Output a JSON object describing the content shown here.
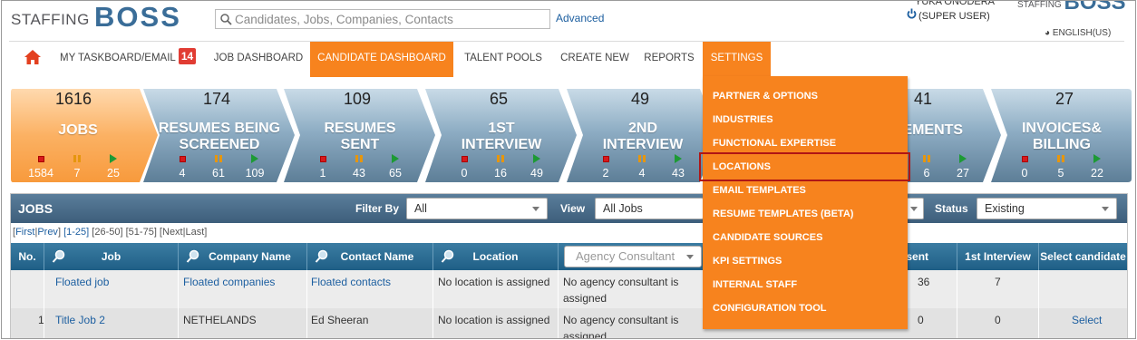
{
  "header": {
    "logo_text": "STAFFING",
    "logo_bold": "BOSS",
    "search_placeholder": "Candidates, Jobs, Companies, Contacts",
    "advanced_label": "Advanced",
    "user_name": "YUKA ONODERA",
    "user_role": "(SUPER USER)",
    "logo2_text": "STAFFING",
    "logo2_bold": "BOSS",
    "language": "ENGLISH(US)"
  },
  "nav": {
    "items": [
      {
        "label": "MY TASKBOARD/EMAIL",
        "badge": "14"
      },
      {
        "label": "JOB DASHBOARD"
      },
      {
        "label": "CANDIDATE DASHBOARD",
        "active": true
      },
      {
        "label": "TALENT POOLS"
      },
      {
        "label": "CREATE NEW"
      },
      {
        "label": "REPORTS"
      },
      {
        "label": "SETTINGS",
        "active": true
      }
    ]
  },
  "pipeline": [
    {
      "count": "1616",
      "label1": "JOBS",
      "label2": "",
      "stats": [
        "1584",
        "7",
        "25"
      ]
    },
    {
      "count": "174",
      "label1": "RESUMES BEING",
      "label2": "SCREENED",
      "stats": [
        "4",
        "61",
        "109"
      ]
    },
    {
      "count": "109",
      "label1": "RESUMES",
      "label2": "SENT",
      "stats": [
        "1",
        "43",
        "65"
      ]
    },
    {
      "count": "65",
      "label1": "1ST",
      "label2": "INTERVIEW",
      "stats": [
        "0",
        "16",
        "49"
      ]
    },
    {
      "count": "49",
      "label1": "2ND",
      "label2": "INTERVIEW",
      "stats": [
        "2",
        "4",
        "43"
      ]
    },
    {
      "count": "41",
      "label1": "CEMENTS",
      "label2": "",
      "stats": [
        "8",
        "6",
        "27"
      ]
    },
    {
      "count": "27",
      "label1": "INVOICES&",
      "label2": "BILLING",
      "stats": [
        "0",
        "5",
        "22"
      ]
    }
  ],
  "jobs_panel": {
    "title": "JOBS",
    "filter_by_label": "Filter By",
    "filter_by_value": "All",
    "view_label": "View",
    "view_value": "All Jobs",
    "status_label": "Status",
    "status_value": "Existing",
    "pager": {
      "first": "First",
      "prev": "Prev",
      "ranges": [
        "1-25",
        "26-50",
        "51-75"
      ],
      "next": "Next",
      "last": "Last"
    },
    "columns": [
      "No.",
      "Job",
      "Company Name",
      "Contact Name",
      "Location",
      "Agency Consultant",
      "mes sent",
      "1st Interview",
      "Select candidate"
    ],
    "rows": [
      {
        "no": "",
        "job": "Floated job",
        "company": "Floated companies",
        "contact": "Floated contacts",
        "location": "No location is assigned",
        "consultant_l1": "No agency consultant is",
        "consultant_l2": "assigned",
        "sent": "36",
        "interview": "7",
        "select": ""
      },
      {
        "no": "1",
        "job": "Title Job 2",
        "company": "NETHELANDS",
        "contact": "Ed Sheeran",
        "location": "No location is assigned",
        "consultant_l1": "No agency consultant is",
        "consultant_l2": "assigned",
        "sent": "0",
        "interview": "0",
        "select": "Select"
      }
    ]
  },
  "settings_menu": [
    "PARTNER & OPTIONS",
    "INDUSTRIES",
    "FUNCTIONAL EXPERTISE",
    "LOCATIONS",
    "EMAIL TEMPLATES",
    "RESUME TEMPLATES (BETA)",
    "CANDIDATE SOURCES",
    "KPI SETTINGS",
    "INTERNAL STAFF",
    "CONFIGURATION TOOL"
  ],
  "colors": {
    "accent": "#f7831e",
    "header_blue": "#1f5f86",
    "badge_red": "#e13c33",
    "highlight_border": "#b01515"
  }
}
